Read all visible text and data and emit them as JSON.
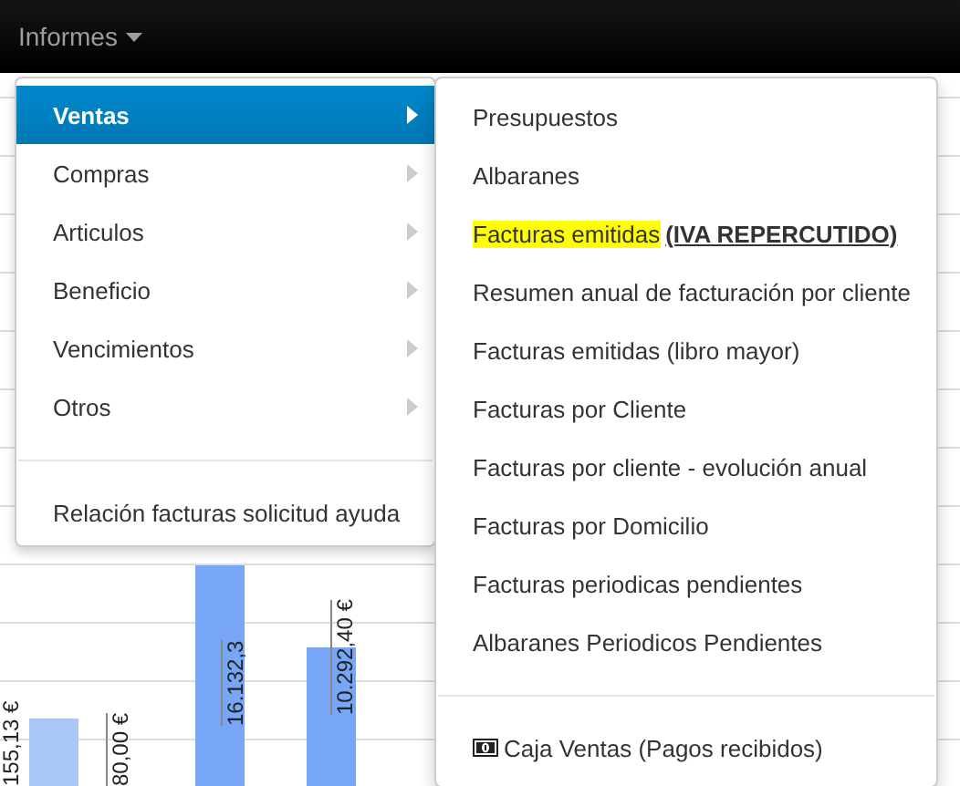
{
  "navbar": {
    "menu": "Informes"
  },
  "menu": {
    "items": [
      {
        "label": "Ventas",
        "selected": true,
        "kind": "submenu"
      },
      {
        "label": "Compras",
        "selected": false,
        "kind": "submenu"
      },
      {
        "label": "Articulos",
        "selected": false,
        "kind": "submenu"
      },
      {
        "label": "Beneficio",
        "selected": false,
        "kind": "submenu"
      },
      {
        "label": "Vencimientos",
        "selected": false,
        "kind": "submenu"
      },
      {
        "label": "Otros",
        "selected": false,
        "kind": "submenu"
      },
      {
        "kind": "divider"
      },
      {
        "label": "Relación facturas solicitud ayuda",
        "selected": false,
        "kind": "link"
      }
    ]
  },
  "submenu": {
    "items": [
      {
        "label": "Presupuestos",
        "kind": "link"
      },
      {
        "label": "Albaranes",
        "kind": "link"
      },
      {
        "label": "Facturas emitidas",
        "highlighted": true,
        "note": "(IVA REPERCUTIDO)",
        "kind": "link"
      },
      {
        "label": "Resumen anual de facturación por cliente",
        "kind": "link"
      },
      {
        "label": "Facturas emitidas (libro mayor)",
        "kind": "link"
      },
      {
        "label": "Facturas por Cliente",
        "kind": "link"
      },
      {
        "label": "Facturas por cliente - evolución anual",
        "kind": "link"
      },
      {
        "label": "Facturas por Domicilio",
        "kind": "link"
      },
      {
        "label": "Facturas periodicas pendientes",
        "kind": "link"
      },
      {
        "label": "Albaranes Periodicos Pendientes",
        "kind": "link"
      },
      {
        "kind": "divider"
      },
      {
        "label": "Caja Ventas (Pagos recibidos)",
        "kind": "cash"
      }
    ]
  },
  "background_chart": {
    "value_labels": [
      "155,13 €",
      "80,00 €",
      "16.132,3",
      "10.292,40 €"
    ]
  }
}
